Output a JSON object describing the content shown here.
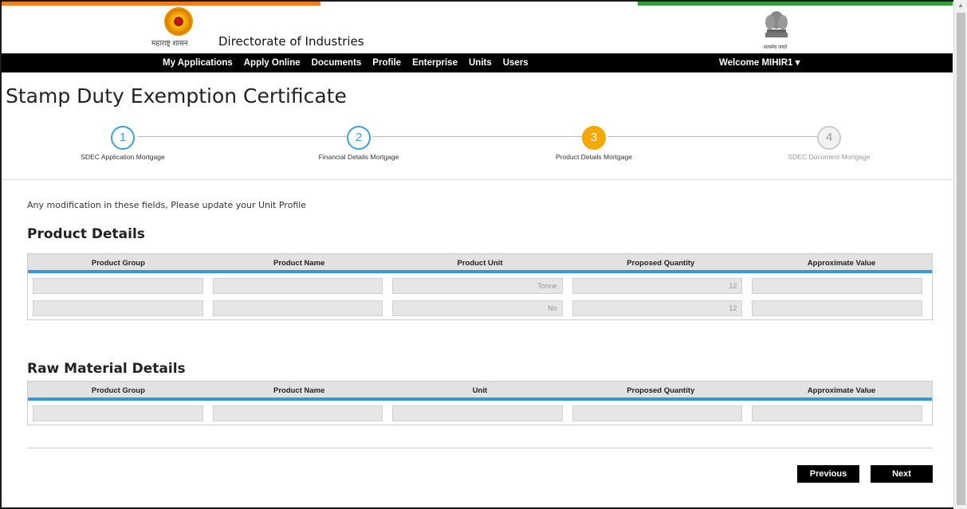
{
  "header": {
    "state_logo_text": "महाराष्ट्र शासन",
    "site_title": "Directorate of Industries",
    "emblem_text": "सत्यमेव जयते"
  },
  "nav": {
    "items": [
      "My Applications",
      "Apply Online",
      "Documents",
      "Profile",
      "Enterprise",
      "Units",
      "Users"
    ],
    "welcome": "Welcome MIHIR1 ▾"
  },
  "page": {
    "title": "Stamp Duty Exemption Certificate",
    "note": "Any modification in these fields, Please update your Unit Profile"
  },
  "steps": [
    {
      "num": "1",
      "label": "SDEC Application Mortgage",
      "state": "done"
    },
    {
      "num": "2",
      "label": "Financial Details Mortgage",
      "state": "done"
    },
    {
      "num": "3",
      "label": "Product Details Mortgage",
      "state": "active"
    },
    {
      "num": "4",
      "label": "SDEC Document Mortgage",
      "state": "disabled"
    }
  ],
  "product_details": {
    "title": "Product Details",
    "columns": [
      "Product Group",
      "Product Name",
      "Product Unit",
      "Proposed Quantity",
      "Approximate Value"
    ],
    "rows": [
      [
        "",
        "",
        "Tonne",
        "12",
        ""
      ],
      [
        "",
        "",
        "No",
        "12",
        ""
      ]
    ]
  },
  "raw_material_details": {
    "title": "Raw Material Details",
    "columns": [
      "Product Group",
      "Product Name",
      "Unit",
      "Proposed Quantity",
      "Approximate Value"
    ],
    "rows": [
      [
        "",
        "",
        "",
        "",
        ""
      ]
    ]
  },
  "buttons": {
    "previous": "Previous",
    "next": "Next"
  },
  "colors": {
    "step_blue": "#3aa0e0",
    "step_active": "#f5a800",
    "table_accent": "#2f9ae2",
    "navbar": "#000000"
  }
}
